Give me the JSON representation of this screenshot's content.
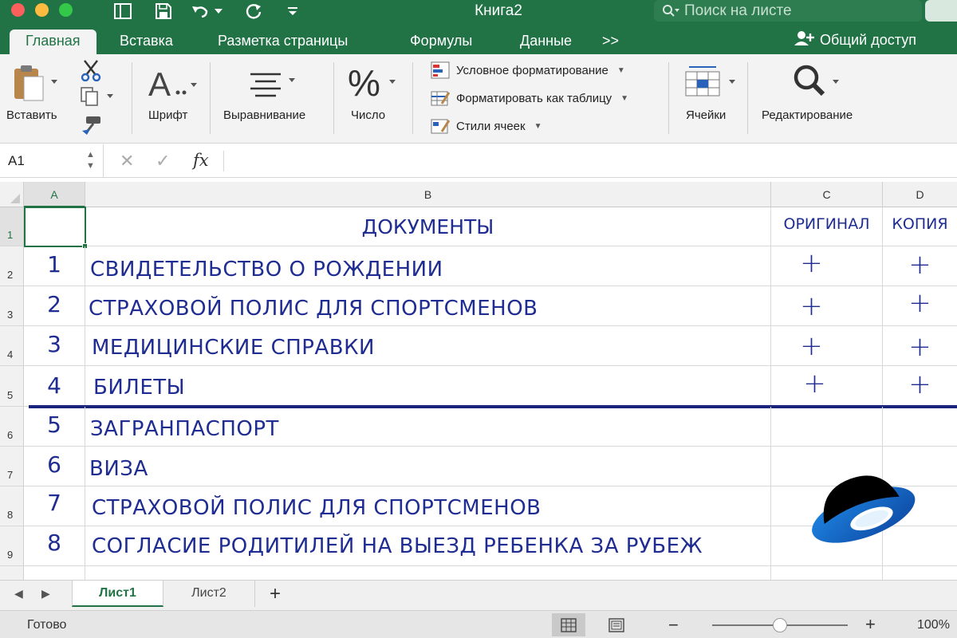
{
  "window": {
    "title": "Книга2",
    "search_placeholder": "Поиск на листе"
  },
  "ribbon_tabs": [
    "Главная",
    "Вставка",
    "Разметка страницы",
    "Формулы",
    "Данные",
    ">>"
  ],
  "share_label": "Общий доступ",
  "ribbon": {
    "paste_label": "Вставить",
    "font_label": "Шрифт",
    "align_label": "Выравнивание",
    "number_label": "Число",
    "cells_label": "Ячейки",
    "editing_label": "Редактирование",
    "styles_menu": [
      "Условное форматирование",
      "Форматировать как таблицу",
      "Стили ячеек"
    ]
  },
  "formula_bar": {
    "name_box": "A1",
    "fx": "fx",
    "formula": ""
  },
  "columns": [
    "A",
    "B",
    "C",
    "D"
  ],
  "rows": [
    "1",
    "2",
    "3",
    "4",
    "5",
    "6",
    "7",
    "8",
    "9"
  ],
  "header_row": {
    "b": "ДОКУМЕНТЫ",
    "c": "ОРИГИНАЛ",
    "d": "КОПИЯ"
  },
  "table": [
    {
      "num": "1",
      "doc": "СВИДЕТЕЛЬСТВО О РОЖДЕНИИ",
      "orig": "+",
      "copy": "+"
    },
    {
      "num": "2",
      "doc": "СТРАХОВОЙ ПОЛИС ДЛЯ СПОРТСМЕНОВ",
      "orig": "+",
      "copy": "+"
    },
    {
      "num": "3",
      "doc": "МЕДИЦИНСКИЕ СПРАВКИ",
      "orig": "+",
      "copy": "+"
    },
    {
      "num": "4",
      "doc": "БИЛЕТЫ",
      "orig": "+",
      "copy": "+"
    },
    {
      "num": "5",
      "doc": "ЗАГРАНПАСПОРТ",
      "orig": "",
      "copy": ""
    },
    {
      "num": "6",
      "doc": "ВИЗА",
      "orig": "",
      "copy": ""
    },
    {
      "num": "7",
      "doc": "СТРАХОВОЙ ПОЛИС ДЛЯ СПОРТСМЕНОВ",
      "orig": "",
      "copy": ""
    },
    {
      "num": "8",
      "doc": "СОГЛАСИЕ РОДИТИЛЕЙ НА ВЫЕЗД РЕБЕНКА ЗА РУБЕЖ",
      "orig": "",
      "copy": ""
    }
  ],
  "sheets": [
    "Лист1",
    "Лист2"
  ],
  "active_sheet": "Лист1",
  "status": {
    "ready": "Готово",
    "zoom": "100%",
    "zoom_percent": 100
  },
  "colors": {
    "excel_green": "#217346",
    "ink_blue": "#1f2c91",
    "divider_navy": "#1a237e"
  },
  "icons": [
    "paste-icon",
    "cut-icon",
    "copy-icon",
    "format-painter-icon",
    "font-icon",
    "align-icon",
    "percent-icon",
    "conditional-format-icon",
    "format-table-icon",
    "cell-styles-icon",
    "cells-icon",
    "search-magnifier-icon",
    "yandex-ufo-logo"
  ]
}
